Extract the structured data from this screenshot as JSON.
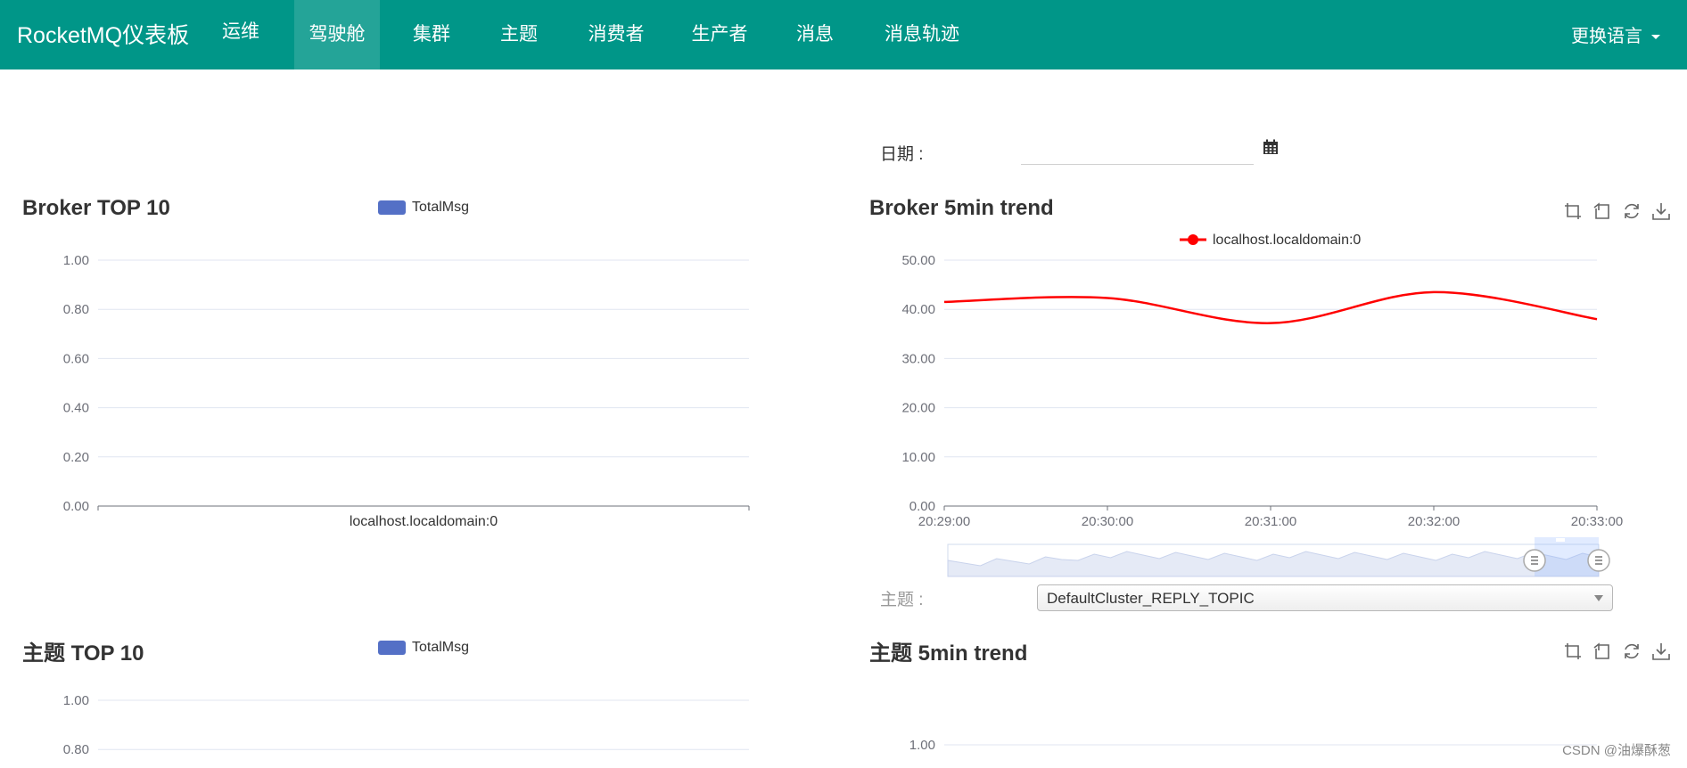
{
  "nav": {
    "brand": "RocketMQ仪表板",
    "items": [
      {
        "label": "运维",
        "active": false
      },
      {
        "label": "驾驶舱",
        "active": true
      },
      {
        "label": "集群",
        "active": false
      },
      {
        "label": "主题",
        "active": false
      },
      {
        "label": "消费者",
        "active": false
      },
      {
        "label": "生产者",
        "active": false
      },
      {
        "label": "消息",
        "active": false
      },
      {
        "label": "消息轨迹",
        "active": false
      }
    ],
    "language": "更换语言"
  },
  "date": {
    "label": "日期 :",
    "value": ""
  },
  "topic_select": {
    "label": "主题 :",
    "value": "DefaultCluster_REPLY_TOPIC"
  },
  "watermark": "CSDN @油爆酥葱",
  "panels": {
    "broker_top": {
      "title": "Broker TOP 10",
      "legend": "TotalMsg"
    },
    "broker_trend": {
      "title": "Broker 5min trend",
      "legend": "localhost.localdomain:0"
    },
    "topic_top": {
      "title": "主题 TOP 10",
      "legend": "TotalMsg"
    },
    "topic_trend": {
      "title": "主题 5min trend"
    }
  },
  "icons": [
    "calendar-icon",
    "zoom-icon",
    "zoom-reset-icon",
    "restore-icon",
    "save-image-icon"
  ],
  "colors": {
    "nav": "#009688",
    "bar_series": "#5470c6",
    "line_series": "#ff0000"
  },
  "chart_data": [
    {
      "type": "bar",
      "title": "Broker TOP 10",
      "categories": [
        "localhost.localdomain:0"
      ],
      "series": [
        {
          "name": "TotalMsg",
          "values": [
            0
          ]
        }
      ],
      "yticks": [
        "0.00",
        "0.20",
        "0.40",
        "0.60",
        "0.80",
        "1.00"
      ],
      "ylim": [
        0,
        1
      ]
    },
    {
      "type": "line",
      "title": "Broker 5min trend",
      "x": [
        "20:29:00",
        "20:30:00",
        "20:31:00",
        "20:32:00",
        "20:33:00"
      ],
      "series": [
        {
          "name": "localhost.localdomain:0",
          "values": [
            41.5,
            42.3,
            37.2,
            43.5,
            38.0
          ]
        }
      ],
      "yticks": [
        "0.00",
        "10.00",
        "20.00",
        "30.00",
        "40.00",
        "50.00"
      ],
      "ylim": [
        0,
        50
      ],
      "smooth": true,
      "dataZoom": true
    },
    {
      "type": "bar",
      "title": "主题 TOP 10",
      "categories": [],
      "series": [
        {
          "name": "TotalMsg",
          "values": []
        }
      ],
      "yticks": [
        "0.80",
        "1.00"
      ],
      "ylim": [
        0,
        1
      ]
    },
    {
      "type": "line",
      "title": "主题 5min trend",
      "x": [],
      "series": [],
      "yticks": [
        "1.00"
      ],
      "ylim": [
        0,
        1
      ]
    }
  ]
}
